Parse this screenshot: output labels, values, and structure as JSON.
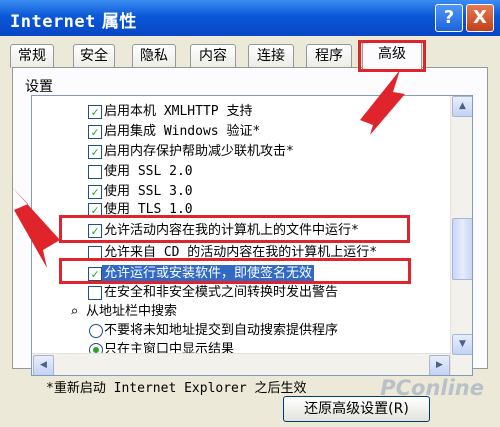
{
  "window": {
    "title_en": "Internet",
    "title_cn": "属性",
    "help_label": "?",
    "close_label": "X"
  },
  "tabs": [
    {
      "label": "常规"
    },
    {
      "label": "安全"
    },
    {
      "label": "隐私"
    },
    {
      "label": "内容"
    },
    {
      "label": "连接"
    },
    {
      "label": "程序"
    },
    {
      "label": "高级",
      "active": true
    }
  ],
  "section_label": "设置",
  "settings": [
    {
      "type": "checkbox",
      "checked": true,
      "label": "启用本机 XMLHTTP 支持"
    },
    {
      "type": "checkbox",
      "checked": true,
      "label": "启用集成 Windows 验证*"
    },
    {
      "type": "checkbox",
      "checked": true,
      "label": "启用内存保护帮助减少联机攻击*"
    },
    {
      "type": "checkbox",
      "checked": false,
      "label": "使用 SSL 2.0"
    },
    {
      "type": "checkbox",
      "checked": true,
      "label": "使用 SSL 3.0"
    },
    {
      "type": "checkbox",
      "checked": true,
      "label": "使用 TLS 1.0"
    },
    {
      "type": "checkbox",
      "checked": true,
      "label": "允许活动内容在我的计算机上的文件中运行*"
    },
    {
      "type": "checkbox",
      "checked": false,
      "label": "允许来自 CD 的活动内容在我的计算机上运行*"
    },
    {
      "type": "checkbox",
      "checked": true,
      "selected": true,
      "label": "允许运行或安装软件，即使签名无效"
    },
    {
      "type": "checkbox",
      "checked": false,
      "label": "在安全和非安全模式之间转换时发出警告"
    },
    {
      "type": "group",
      "icon": "magnifier-icon",
      "label": "从地址栏中搜索"
    },
    {
      "type": "radio",
      "checked": false,
      "label": "不要将未知地址提交到自动搜索提供程序"
    },
    {
      "type": "radio",
      "checked": true,
      "label": "只在主窗口中显示结果"
    }
  ],
  "restart_note": "*重新启动 Internet Explorer 之后生效",
  "restore_button": "还原高级设置(R)",
  "watermark": "PConline",
  "colors": {
    "titlebar": "#0a58d8",
    "highlight_box": "#e0242c",
    "selection": "#316ac5"
  }
}
